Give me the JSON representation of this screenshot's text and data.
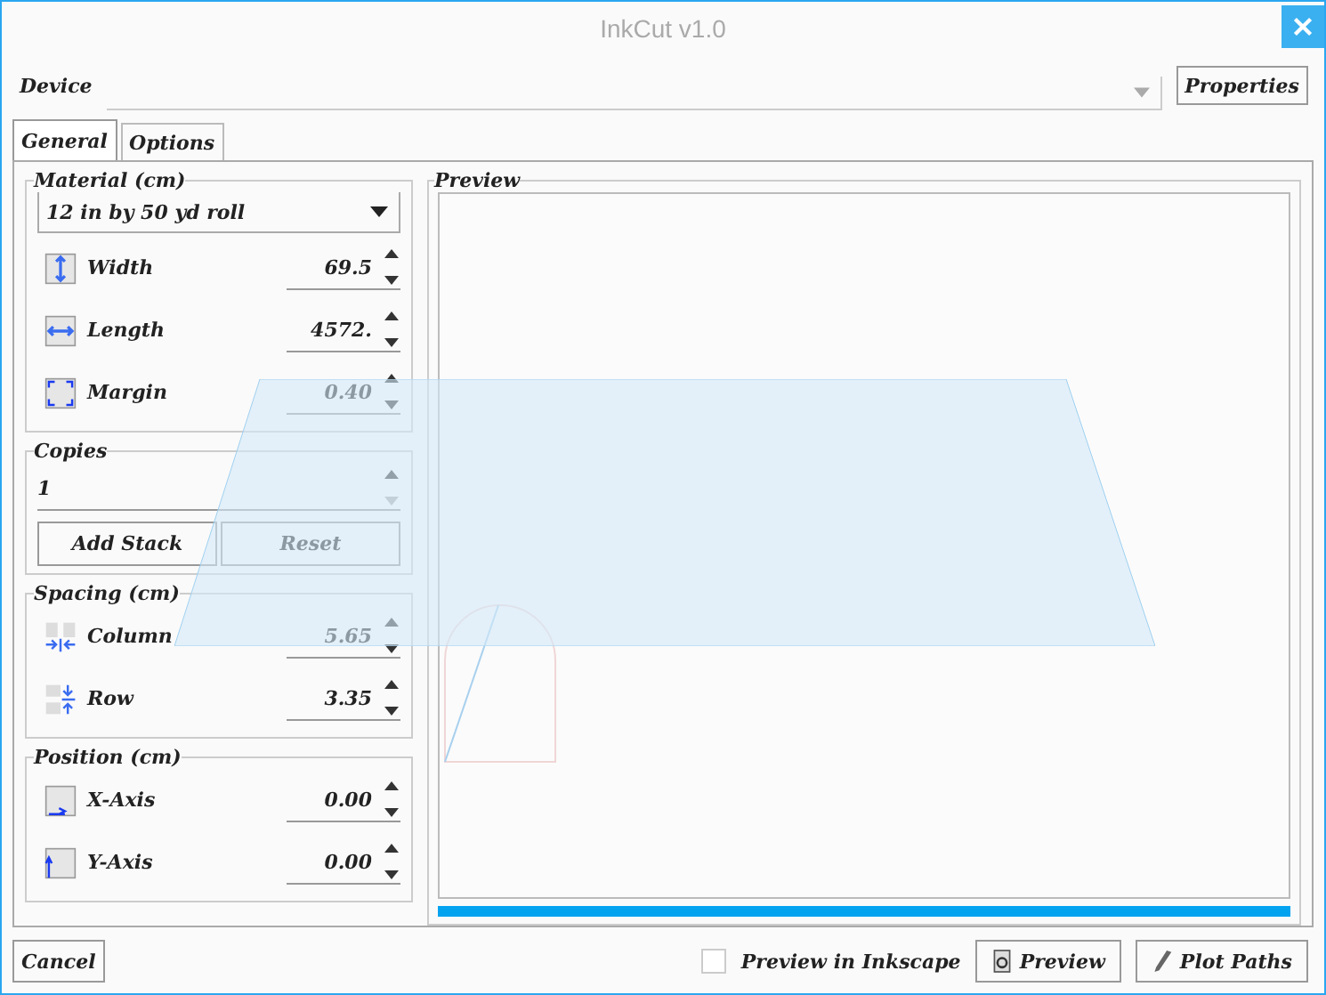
{
  "window": {
    "title": "InkCut v1.0"
  },
  "device": {
    "label": "Device",
    "properties_button": "Properties"
  },
  "tabs": [
    {
      "label": "General",
      "selected": true
    },
    {
      "label": "Options",
      "selected": false
    }
  ],
  "material": {
    "title": "Material (cm)",
    "roll": "12 in by 50 yd roll",
    "fields": [
      {
        "kind": "width",
        "label": "Width",
        "value": "69.5"
      },
      {
        "kind": "length",
        "label": "Length",
        "value": "4572."
      },
      {
        "kind": "margin",
        "label": "Margin",
        "value": "0.40"
      }
    ]
  },
  "copies": {
    "title": "Copies",
    "value": "1",
    "buttons": [
      "Add Stack",
      "Reset"
    ]
  },
  "spacing": {
    "title": "Spacing (cm)",
    "fields": [
      {
        "kind": "column",
        "label": "Column",
        "value": "5.65"
      },
      {
        "kind": "row",
        "label": "Row",
        "value": "3.35"
      }
    ]
  },
  "position": {
    "title": "Position (cm)",
    "fields": [
      {
        "kind": "x",
        "label": "X-Axis",
        "value": "0.00"
      },
      {
        "kind": "y",
        "label": "Y-Axis",
        "value": "0.00"
      }
    ]
  },
  "preview": {
    "title": "Preview",
    "progress": {
      "level": 1
    }
  },
  "footer": {
    "cancel": "Cancel",
    "inkscape": {
      "label": "Preview in Inkscape",
      "checked": false
    },
    "preview_button": "Preview",
    "plot_button": "Plot Paths"
  }
}
